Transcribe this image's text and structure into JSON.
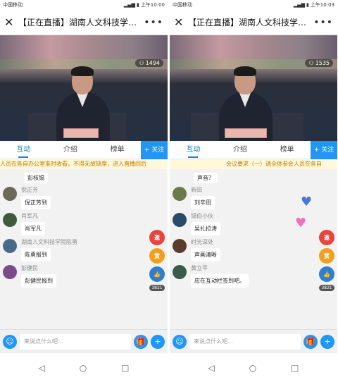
{
  "screens": [
    {
      "status": {
        "carrier": "中国移动",
        "time": "上午10:00"
      },
      "title": "【正在直播】湖南人文科技学院...",
      "viewer_count": "1494",
      "tabs": [
        "互动",
        "介绍",
        "榜单"
      ],
      "follow_label": "+ 关注",
      "marquee": "人员在各自办公室准时收看，不得无故缺席，进入直播间后",
      "top_bubble": "彭核锡",
      "messages": [
        {
          "name": "倪正芳",
          "text": "倪正芳到"
        },
        {
          "name": "肖军凡",
          "text": "肖军凡"
        },
        {
          "name": "湖南人文科技学院陈勇",
          "text": "陈勇报到"
        },
        {
          "name": "彭健民",
          "text": "彭健民报到"
        }
      ],
      "side": {
        "invite": "邀",
        "reward": "赏",
        "like_count": "3821"
      },
      "input_placeholder": "来说点什么吧...",
      "colors": {
        "avatars": [
          "#6a6a5a",
          "#3d5a3d",
          "#4a6a8a",
          "#7a4a8a"
        ]
      }
    },
    {
      "status": {
        "carrier": "中国移动",
        "time": "上午10:03"
      },
      "title": "【正在直播】湖南人文科技学院...",
      "viewer_count": "1535",
      "tabs": [
        "互动",
        "介绍",
        "榜单"
      ],
      "follow_label": "+ 关注",
      "marquee": "会议要求（一）请全体参会人员在各自",
      "top_bubble": "声音？",
      "messages": [
        {
          "name": "新田",
          "text": "刘辛田"
        },
        {
          "name": "锡伯小伙",
          "text": "吴扎拉涛"
        },
        {
          "name": "时光深处",
          "text": "声画清晰"
        },
        {
          "name": "黄立平",
          "text": "应在互动栏签到吧。"
        }
      ],
      "side": {
        "invite": "邀",
        "reward": "赏",
        "like_count": "3821"
      },
      "input_placeholder": "来说点什么吧...",
      "colors": {
        "avatars": [
          "#6a7a4a",
          "#2a4a6a",
          "#5a3a2a",
          "#3a5a4a"
        ]
      }
    }
  ],
  "colors": {
    "accent": "#1b7fd6",
    "follow": "#2196f3",
    "invite": "#e8453c",
    "reward": "#f0a020",
    "like": "#2f7fd0",
    "heart_blue": "#4a78d8",
    "heart_pink": "#f070b8"
  }
}
